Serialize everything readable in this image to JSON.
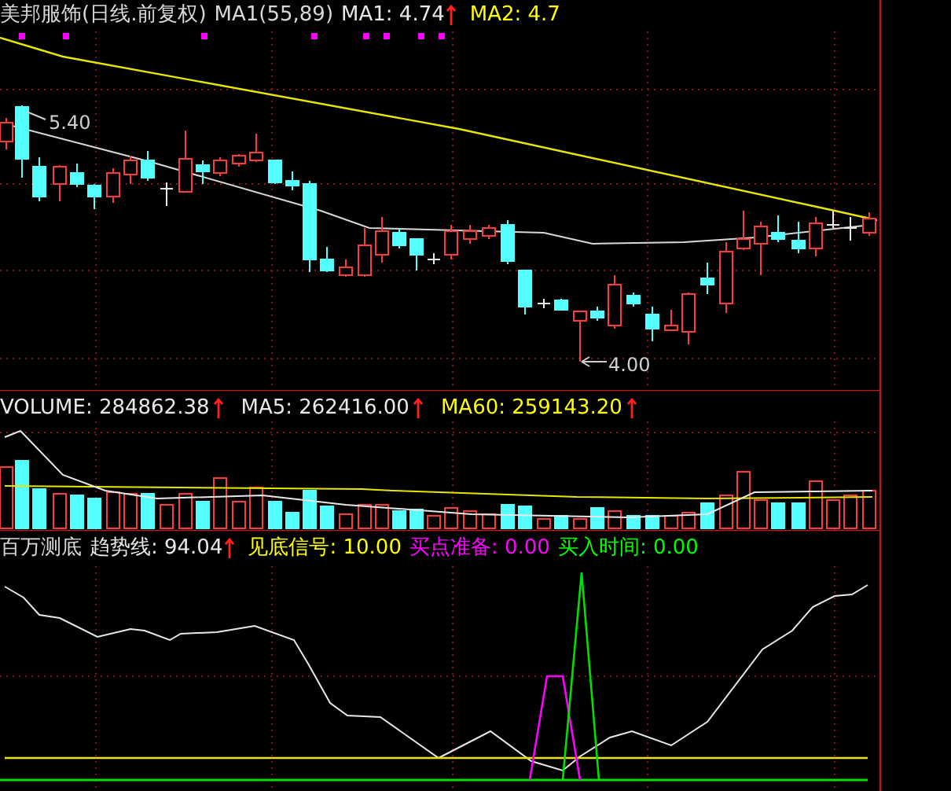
{
  "price_panel": {
    "title": "美邦服饰(日线.前复权)",
    "params": "MA1(55,89)",
    "legend": [
      {
        "text": "MA1: 4.74",
        "color": "#e8e8e8",
        "arrow": true
      },
      {
        "text": "MA2: 4.7",
        "color": "#ffff00",
        "arrow": false
      }
    ],
    "annotations": [
      {
        "text": "5.40"
      },
      {
        "text": "4.00"
      }
    ]
  },
  "volume_panel": {
    "legend": [
      {
        "text": "VOLUME: 284862.38",
        "color": "#e8e8e8",
        "arrow": true
      },
      {
        "text": "MA5: 262416.00",
        "color": "#e8e8e8",
        "arrow": true
      },
      {
        "text": "MA60: 259143.20",
        "color": "#ffff00",
        "arrow": true
      }
    ]
  },
  "indicator_panel": {
    "title": "百万测底",
    "legend": [
      {
        "text": "趋势线: 94.04",
        "color": "#e8e8e8",
        "arrow": true
      },
      {
        "text": "见底信号: 10.00",
        "color": "#ffff00",
        "arrow": false
      },
      {
        "text": "买点准备: 0.00",
        "color": "#ff00ff",
        "arrow": false
      },
      {
        "text": "买入时间: 0.00",
        "color": "#00ff00",
        "arrow": false
      }
    ]
  }
}
